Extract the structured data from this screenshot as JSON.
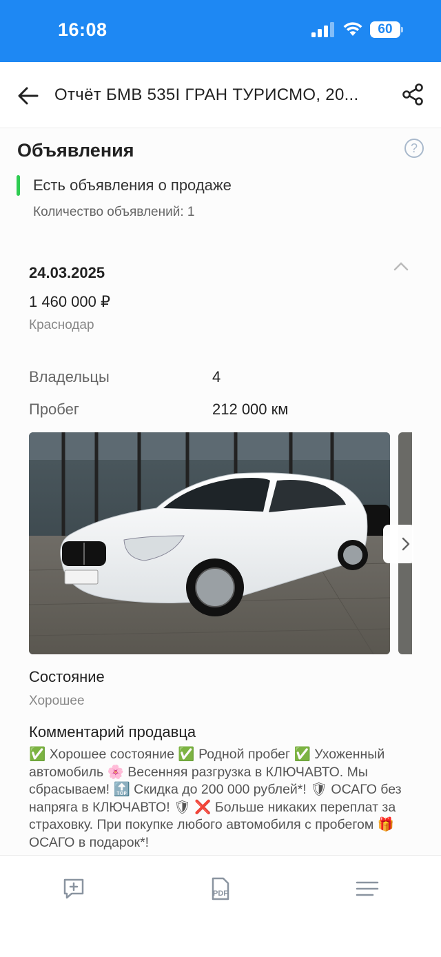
{
  "status_bar": {
    "time": "16:08",
    "battery": "60"
  },
  "app_bar": {
    "title": "Отчёт БМВ 535I ГРАН ТУРИСМО, 20..."
  },
  "section": {
    "title": "Объявления",
    "status_text": "Есть объявления о продаже",
    "count_text": "Количество объявлений: 1"
  },
  "listing": {
    "date": "24.03.2025",
    "price": "1 460 000 ₽",
    "city": "Краснодар",
    "owners_label": "Владельцы",
    "owners_value": "4",
    "mileage_label": "Пробег",
    "mileage_value": "212 000 км",
    "condition_label": "Состояние",
    "condition_value": "Хорошее",
    "comment_label": "Комментарий продавца",
    "comment_text": "✅ Хорошее состояние ✅ Родной пробег ✅ Ухоженный автомобиль 🌸 Весенняя разгрузка в КЛЮЧАВТО. Мы сбрасываем! 🔝 Скидка до 200 000 рублей*! 🛡 ОСАГО без напряга в КЛЮЧАВТО! 🛡 ❌ Больше никаких переплат за страховку. При покупке любого автомобиля с пробегом 🎁ОСАГО в подарок*!"
  },
  "colors": {
    "brand_blue": "#1e88f3",
    "status_green": "#2ecc52"
  },
  "icons": {
    "back": "arrow-left-icon",
    "share": "share-icon",
    "help": "question-circle-icon",
    "collapse": "chevron-up-icon",
    "gallery_next": "chevron-right-icon",
    "bottom": [
      "comment-add-icon",
      "pdf-icon",
      "menu-icon"
    ]
  },
  "bottom_bar": {
    "pdf_label": "PDF"
  }
}
